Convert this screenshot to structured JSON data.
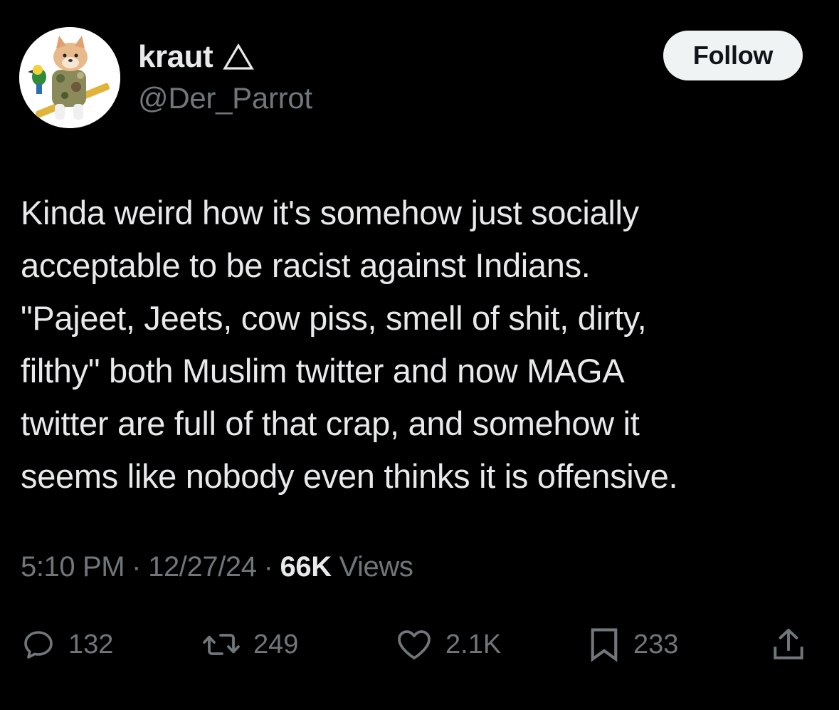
{
  "user": {
    "display_name": "kraut",
    "handle": "@Der_Parrot",
    "badge_icon": "triangle-icon",
    "avatar_icon": "dog-avatar-icon"
  },
  "follow_button": {
    "label": "Follow"
  },
  "tweet": {
    "text": "Kinda weird how it's somehow just socially\nacceptable to be racist against Indians.\n\"Pajeet, Jeets, cow piss, smell of shit, dirty,\nfilthy\" both Muslim twitter and now MAGA\ntwitter are full of that crap, and somehow it\nseems like nobody even thinks it is offensive.",
    "time": "5:10 PM",
    "separator": "·",
    "date": "12/27/24",
    "views_count": "66K",
    "views_label": "Views"
  },
  "actions": {
    "replies": {
      "icon": "reply-icon",
      "count": "132"
    },
    "reposts": {
      "icon": "repost-icon",
      "count": "249"
    },
    "likes": {
      "icon": "heart-icon",
      "count": "2.1K"
    },
    "bookmarks": {
      "icon": "bookmark-icon",
      "count": "233"
    },
    "share": {
      "icon": "share-icon"
    }
  },
  "colors": {
    "background": "#000000",
    "primary_text": "#e7e9ea",
    "secondary_text": "#71767b",
    "follow_bg": "#eff3f4"
  }
}
